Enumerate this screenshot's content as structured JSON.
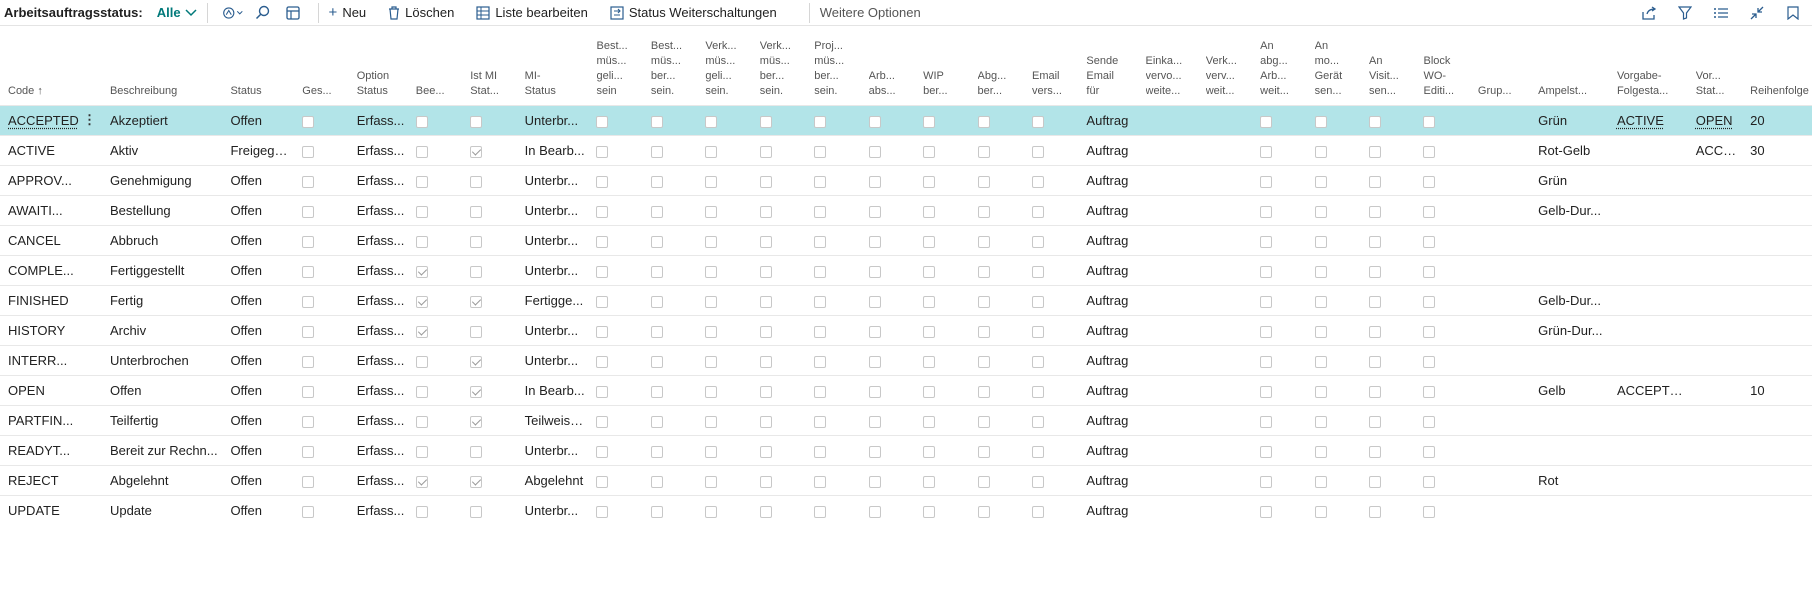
{
  "toolbar": {
    "title": "Arbeitsauftragsstatus:",
    "filter": "Alle",
    "new_label": "Neu",
    "delete_label": "Löschen",
    "edit_list_label": "Liste bearbeiten",
    "status_switch_label": "Status Weiterschaltungen",
    "more_label": "Weitere Optionen"
  },
  "columns": [
    [
      "Code ↑"
    ],
    [
      "Beschreibung"
    ],
    [
      "Status"
    ],
    [
      "Ges..."
    ],
    [
      "Option",
      "Status"
    ],
    [
      "Bee..."
    ],
    [
      "Ist MI",
      "Stat..."
    ],
    [
      "MI-",
      "Status"
    ],
    [
      "Best...",
      "müs...",
      "geli...",
      "sein"
    ],
    [
      "Best...",
      "müs...",
      "ber...",
      "sein."
    ],
    [
      "Verk...",
      "müs...",
      "geli...",
      "sein."
    ],
    [
      "Verk...",
      "müs...",
      "ber...",
      "sein."
    ],
    [
      "Proj...",
      "müs...",
      "ber...",
      "sein."
    ],
    [
      "Arb...",
      "abs..."
    ],
    [
      "WIP",
      "ber..."
    ],
    [
      "Abg...",
      "ber..."
    ],
    [
      "Email",
      "vers..."
    ],
    [
      "Sende",
      "Email",
      "für"
    ],
    [
      "Einka...",
      "vervo...",
      "weite..."
    ],
    [
      "Verk...",
      "verv...",
      "weit..."
    ],
    [
      "An",
      "abg...",
      "Arb...",
      "weit..."
    ],
    [
      "An",
      "mo...",
      "Gerät",
      "sen..."
    ],
    [
      "An",
      "Visit...",
      "sen..."
    ],
    [
      "Block",
      "WO-",
      "Editi..."
    ],
    [
      "Grup..."
    ],
    [
      "Ampelst..."
    ],
    [
      "Vorgabe-",
      "Folgesta..."
    ],
    [
      "Vor...",
      "Stat..."
    ],
    [
      "Reihenfolge"
    ]
  ],
  "rows": [
    {
      "code": "ACCEPTED",
      "desc": "Akzeptiert",
      "status": "Offen",
      "opt": "Erfass...",
      "bee": false,
      "ist": false,
      "mi": "Unterbr...",
      "sende": "Auftrag",
      "ampel": "Grün",
      "vorgabe": "ACTIVE",
      "vor": "OPEN",
      "reihe": "20"
    },
    {
      "code": "ACTIVE",
      "desc": "Aktiv",
      "status": "Freigege...",
      "opt": "Erfass...",
      "bee": false,
      "ist": true,
      "mi": "In Bearb...",
      "sende": "Auftrag",
      "ampel": "Rot-Gelb",
      "vorgabe": "",
      "vor": "ACCE...",
      "reihe": "30"
    },
    {
      "code": "APPROV...",
      "desc": "Genehmigung",
      "status": "Offen",
      "opt": "Erfass...",
      "bee": false,
      "ist": false,
      "mi": "Unterbr...",
      "sende": "Auftrag",
      "ampel": "Grün",
      "vorgabe": "",
      "vor": "",
      "reihe": ""
    },
    {
      "code": "AWAITI...",
      "desc": "Bestellung",
      "status": "Offen",
      "opt": "Erfass...",
      "bee": false,
      "ist": false,
      "mi": "Unterbr...",
      "sende": "Auftrag",
      "ampel": "Gelb-Dur...",
      "vorgabe": "",
      "vor": "",
      "reihe": ""
    },
    {
      "code": "CANCEL",
      "desc": "Abbruch",
      "status": "Offen",
      "opt": "Erfass...",
      "bee": false,
      "ist": false,
      "mi": "Unterbr...",
      "sende": "Auftrag",
      "ampel": "",
      "vorgabe": "",
      "vor": "",
      "reihe": ""
    },
    {
      "code": "COMPLE...",
      "desc": "Fertiggestellt",
      "status": "Offen",
      "opt": "Erfass...",
      "bee": true,
      "ist": false,
      "mi": "Unterbr...",
      "sende": "Auftrag",
      "ampel": "",
      "vorgabe": "",
      "vor": "",
      "reihe": ""
    },
    {
      "code": "FINISHED",
      "desc": "Fertig",
      "status": "Offen",
      "opt": "Erfass...",
      "bee": true,
      "ist": true,
      "mi": "Fertigge...",
      "sende": "Auftrag",
      "ampel": "Gelb-Dur...",
      "vorgabe": "",
      "vor": "",
      "reihe": ""
    },
    {
      "code": "HISTORY",
      "desc": "Archiv",
      "status": "Offen",
      "opt": "Erfass...",
      "bee": true,
      "ist": false,
      "mi": "Unterbr...",
      "sende": "Auftrag",
      "ampel": "Grün-Dur...",
      "vorgabe": "",
      "vor": "",
      "reihe": ""
    },
    {
      "code": "INTERR...",
      "desc": "Unterbrochen",
      "status": "Offen",
      "opt": "Erfass...",
      "bee": false,
      "ist": true,
      "mi": "Unterbr...",
      "sende": "Auftrag",
      "ampel": "",
      "vorgabe": "",
      "vor": "",
      "reihe": ""
    },
    {
      "code": "OPEN",
      "desc": "Offen",
      "status": "Offen",
      "opt": "Erfass...",
      "bee": false,
      "ist": true,
      "mi": "In Bearb...",
      "sende": "Auftrag",
      "ampel": "Gelb",
      "vorgabe": "ACCEPTED",
      "vor": "",
      "reihe": "10"
    },
    {
      "code": "PARTFIN...",
      "desc": "Teilfertig",
      "status": "Offen",
      "opt": "Erfass...",
      "bee": false,
      "ist": true,
      "mi": "Teilweise...",
      "sende": "Auftrag",
      "ampel": "",
      "vorgabe": "",
      "vor": "",
      "reihe": ""
    },
    {
      "code": "READYT...",
      "desc": "Bereit zur Rechn...",
      "status": "Offen",
      "opt": "Erfass...",
      "bee": false,
      "ist": false,
      "mi": "Unterbr...",
      "sende": "Auftrag",
      "ampel": "",
      "vorgabe": "",
      "vor": "",
      "reihe": ""
    },
    {
      "code": "REJECT",
      "desc": "Abgelehnt",
      "status": "Offen",
      "opt": "Erfass...",
      "bee": true,
      "ist": true,
      "mi": "Abgelehnt",
      "sende": "Auftrag",
      "ampel": "Rot",
      "vorgabe": "",
      "vor": "",
      "reihe": ""
    },
    {
      "code": "UPDATE",
      "desc": "Update",
      "status": "Offen",
      "opt": "Erfass...",
      "bee": false,
      "ist": false,
      "mi": "Unterbr...",
      "sende": "Auftrag",
      "ampel": "",
      "vorgabe": "",
      "vor": "",
      "reihe": ""
    }
  ]
}
